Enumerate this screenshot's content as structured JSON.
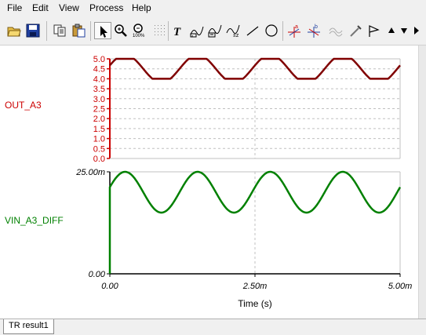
{
  "menu": [
    "File",
    "Edit",
    "View",
    "Process",
    "Help"
  ],
  "toolbar": {
    "icons": [
      "open-folder-icon",
      "save-disk-icon",
      "copy-icon",
      "paste-icon",
      "pointer-icon",
      "zoom-in-icon",
      "zoom-100-icon",
      "grid-icon",
      "text-icon",
      "cursor-a-icon",
      "cursor-b-icon",
      "tolerance-icon",
      "line-icon",
      "circle-icon",
      "cursor-a-red-icon",
      "cursor-b-blue-icon",
      "curve-icon",
      "probe-icon",
      "flag-icon",
      "up-arrow-icon",
      "down-arrow-icon"
    ]
  },
  "colors": {
    "out": "#cc0000",
    "out_trace": "#800000",
    "vin": "#008000",
    "grid": "#c0c0c0",
    "axis": "#000000"
  },
  "chart_data": [
    {
      "type": "line",
      "series": [
        {
          "name": "OUT_A3",
          "note_shape": "clipped sinusoid (flat top at 5.0, flat bottom near 4.0), 4 cycles"
        }
      ],
      "x": [
        0.0,
        0.00025,
        0.0005,
        0.00075,
        0.001,
        0.00125,
        0.0015,
        0.00175,
        0.002,
        0.00225,
        0.0025,
        0.00275,
        0.003,
        0.00325,
        0.0035,
        0.00375,
        0.004,
        0.00425,
        0.0045,
        0.00475,
        0.005
      ],
      "y": [
        4.6,
        5.0,
        4.5,
        4.0,
        4.5,
        5.0,
        4.5,
        4.0,
        4.5,
        5.0,
        4.5,
        4.0,
        4.5,
        5.0,
        4.5,
        4.0,
        4.5,
        5.0,
        4.5,
        4.0,
        4.5
      ],
      "ylabel": "OUT_A3",
      "yticks": [
        "0.0",
        "0.5",
        "1.0",
        "1.5",
        "2.0",
        "2.5",
        "3.0",
        "3.5",
        "4.0",
        "4.5",
        "5.0"
      ],
      "ylim": [
        0,
        5.0
      ],
      "xlim": [
        0,
        0.005
      ],
      "grid": true
    },
    {
      "type": "line",
      "series": [
        {
          "name": "VIN_A3_DIFF"
        }
      ],
      "x": [
        0.0,
        0.00025,
        0.0005,
        0.00075,
        0.001,
        0.00125,
        0.0015,
        0.00175,
        0.002,
        0.00225,
        0.0025,
        0.00275,
        0.003,
        0.00325,
        0.0035,
        0.00375,
        0.004,
        0.00425,
        0.0045,
        0.00475,
        0.005
      ],
      "y": [
        0.02,
        0.025,
        0.02,
        0.015,
        0.02,
        0.025,
        0.02,
        0.015,
        0.02,
        0.025,
        0.02,
        0.015,
        0.02,
        0.025,
        0.02,
        0.015,
        0.02,
        0.025,
        0.02,
        0.015,
        0.02
      ],
      "ylabel": "VIN_A3_DIFF",
      "yticks": [
        "0.00",
        "25.00m"
      ],
      "ylim": [
        0,
        0.025
      ],
      "xlim": [
        0,
        0.005
      ],
      "xticks": [
        "0.00",
        "2.50m",
        "5.00m"
      ],
      "xlabel": "Time (s)",
      "grid": true
    }
  ],
  "tabs": [
    "TR result1"
  ]
}
